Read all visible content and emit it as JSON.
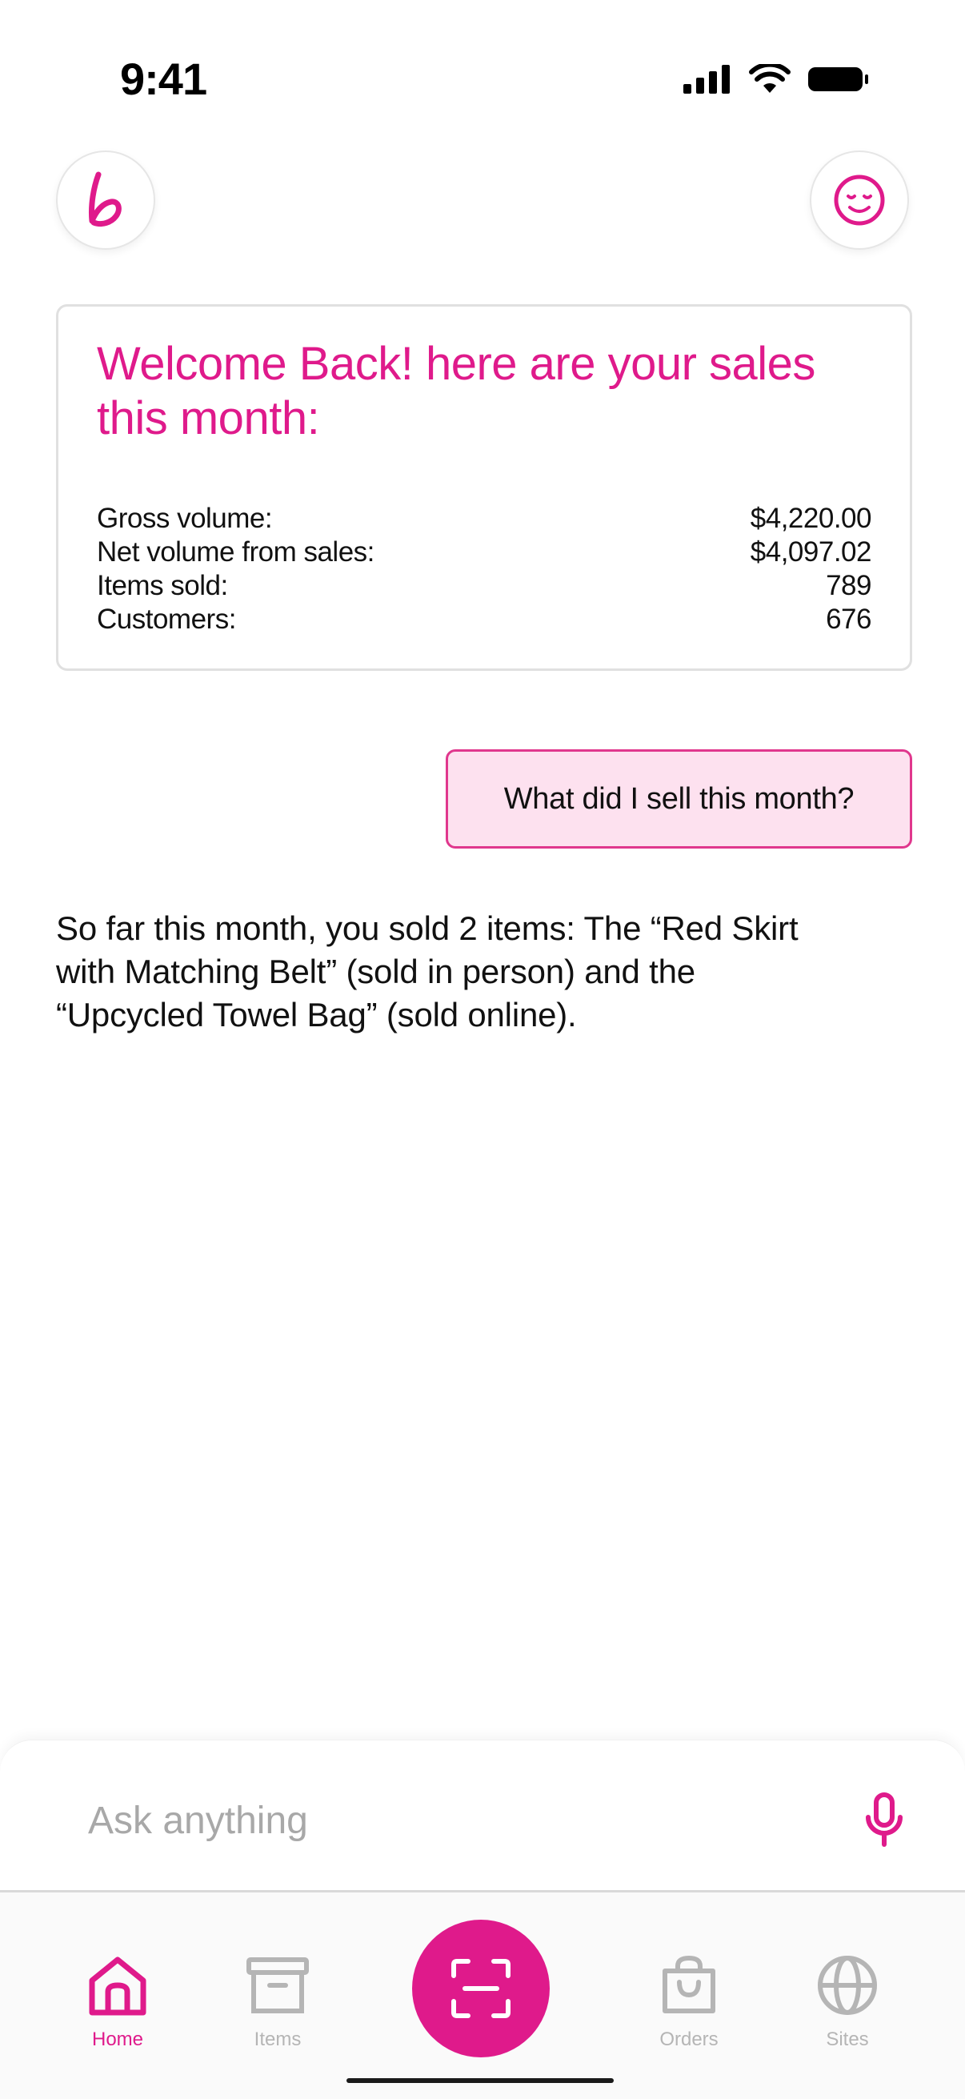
{
  "status_bar": {
    "time": "9:41"
  },
  "header": {
    "logo_letter": "b"
  },
  "sales_card": {
    "title": "Welcome Back! here are your sales this month:",
    "stats": [
      {
        "label": "Gross volume:",
        "value": "$4,220.00"
      },
      {
        "label": "Net volume from sales:",
        "value": "$4,097.02"
      },
      {
        "label": "Items sold:",
        "value": "789"
      },
      {
        "label": "Customers:",
        "value": "676"
      }
    ]
  },
  "chat": {
    "user_message": "What did I sell this month?",
    "assistant_reply": "So far this month, you sold 2 items: The “Red Skirt with Matching Belt” (sold in person) and the “Upcycled Towel Bag” (sold online)."
  },
  "ask_bar": {
    "placeholder": "Ask anything"
  },
  "tabs": [
    {
      "label": "Home",
      "icon": "home-icon",
      "active": true
    },
    {
      "label": "Items",
      "icon": "archive-box-icon",
      "active": false
    },
    {
      "label": "Orders",
      "icon": "shopping-bag-icon",
      "active": false
    },
    {
      "label": "Sites",
      "icon": "globe-icon",
      "active": false
    }
  ],
  "colors": {
    "accent": "#df1a8b",
    "bubble_bg": "#fde1ef",
    "inactive": "#b5b5b5"
  }
}
